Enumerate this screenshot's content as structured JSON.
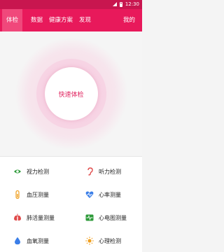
{
  "status_bar": {
    "time": "12:30"
  },
  "nav": {
    "tabs": [
      {
        "label": "体检",
        "active": true
      },
      {
        "label": "数据"
      },
      {
        "label": "健康方案"
      },
      {
        "label": "发现"
      }
    ],
    "profile_label": "我的"
  },
  "hero": {
    "quick_check_label": "快速体检"
  },
  "tests": [
    {
      "label": "视力检测",
      "icon": "eye-icon",
      "color": "#2e9b3a"
    },
    {
      "label": "听力检测",
      "icon": "ear-icon",
      "color": "#e04a4a"
    },
    {
      "label": "血压测量",
      "icon": "thermometer-icon",
      "color": "#f0a020"
    },
    {
      "label": "心率测量",
      "icon": "heart-rate-icon",
      "color": "#3a7ee8"
    },
    {
      "label": "肺活量测量",
      "icon": "lungs-icon",
      "color": "#e04a4a"
    },
    {
      "label": "心电图测量",
      "icon": "ecg-icon",
      "color": "#2e9b3a"
    },
    {
      "label": "血氧测量",
      "icon": "blood-drop-icon",
      "color": "#3a7ee8"
    },
    {
      "label": "心理检测",
      "icon": "sun-icon",
      "color": "#f0a020"
    }
  ]
}
